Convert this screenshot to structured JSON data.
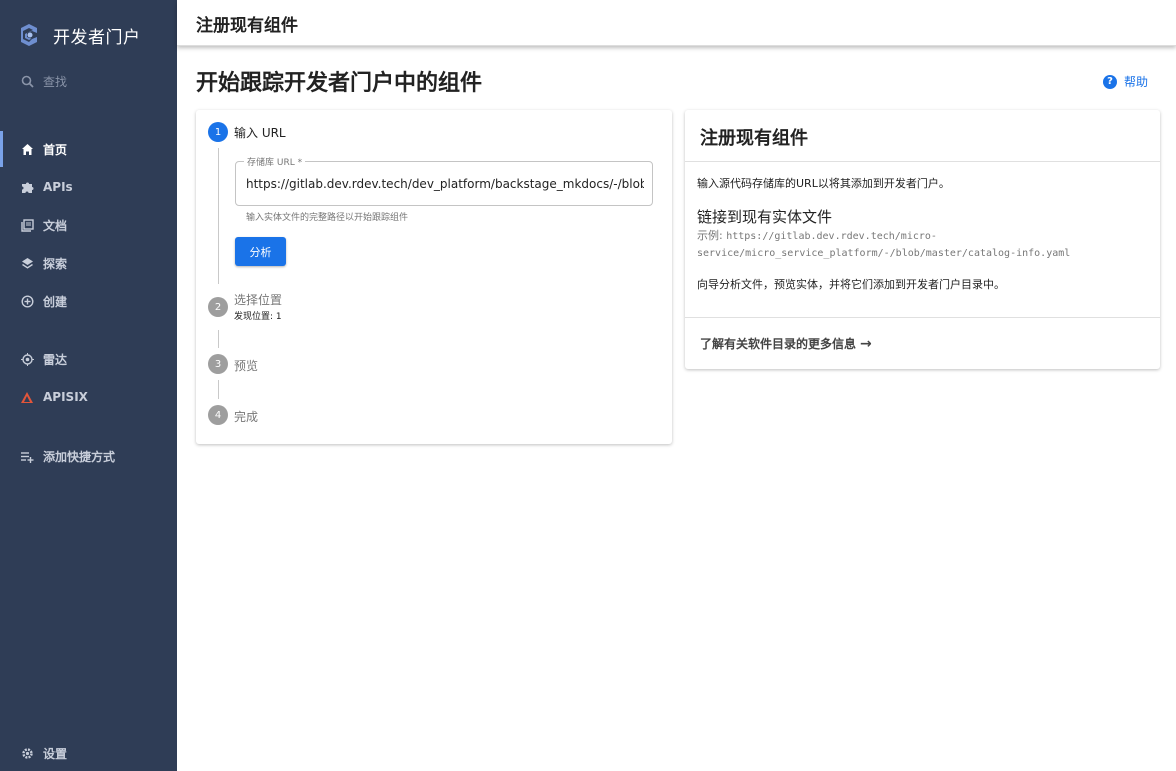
{
  "app": {
    "brand_title": "开发者门户",
    "page_header": "注册现有组件",
    "page_title": "开始跟踪开发者门户中的组件",
    "help_label": "帮助"
  },
  "sidebar": {
    "search_label": "查找",
    "items": [
      {
        "label": "首页",
        "icon": "home-icon",
        "active": true
      },
      {
        "label": "APIs",
        "icon": "puzzle-icon"
      },
      {
        "label": "文档",
        "icon": "docs-icon"
      },
      {
        "label": "探索",
        "icon": "layers-icon"
      },
      {
        "label": "创建",
        "icon": "add-circle-icon"
      },
      {
        "label": "雷达",
        "icon": "radar-icon"
      },
      {
        "label": "APISIX",
        "icon": "apisix-icon"
      },
      {
        "label": "添加快捷方式",
        "icon": "playlist-add-icon"
      }
    ],
    "settings_label": "设置"
  },
  "stepper": {
    "steps": [
      {
        "number": "1",
        "label": "输入 URL",
        "active": true
      },
      {
        "number": "2",
        "label": "选择位置",
        "sub": "发现位置: 1"
      },
      {
        "number": "3",
        "label": "预览"
      },
      {
        "number": "4",
        "label": "完成"
      }
    ],
    "url_field": {
      "label": "存储库 URL *",
      "value": "https://gitlab.dev.rdev.tech/dev_platform/backstage_mkdocs/-/blob/master/catalog-info.yaml",
      "helper": "输入实体文件的完整路径以开始跟踪组件"
    },
    "analyze_label": "分析"
  },
  "info": {
    "title": "注册现有组件",
    "intro": "输入源代码存储库的URL以将其添加到开发者门户。",
    "subtitle": "链接到现有实体文件",
    "example_prefix": "示例: ",
    "example_line1": "https://gitlab.dev.rdev.tech/micro-",
    "example_line2": "service/micro_service_platform/-/blob/master/catalog-info.yaml",
    "description": "向导分析文件，预览实体，并将它们添加到开发者门户目录中。",
    "learn_more": "了解有关软件目录的更多信息"
  },
  "colors": {
    "sidebar_bg": "#2f3d56",
    "accent": "#1a73e8"
  }
}
